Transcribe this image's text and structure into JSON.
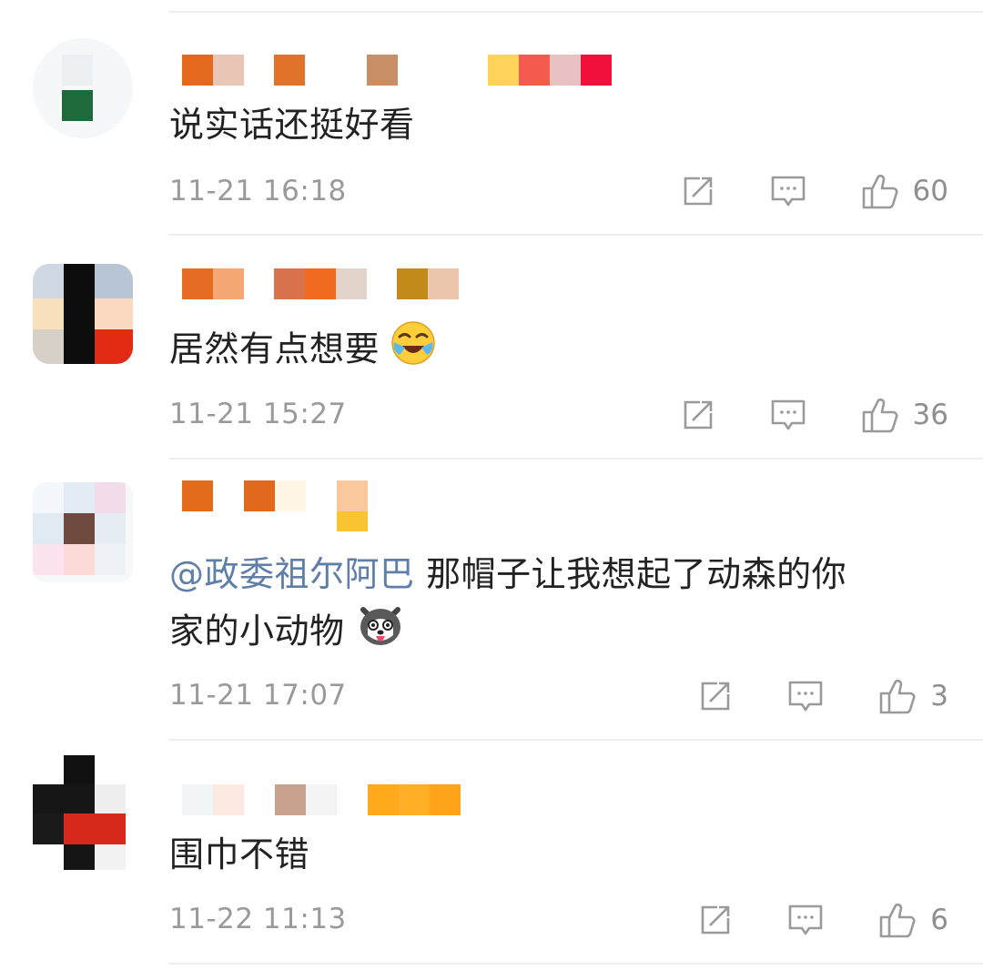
{
  "comments": [
    {
      "text": "说实话还挺好看",
      "time": "11-21 16:18",
      "likes": "60"
    },
    {
      "text": "居然有点想要",
      "emoji": "laugh-cry-emoji",
      "time": "11-21 15:27",
      "likes": "36"
    },
    {
      "mention": "@政委祖尔阿巴",
      "text_line1": " 那帽子让我想起了动森的你",
      "text_line2": "家的小动物",
      "emoji": "husky-emoji",
      "time": "11-21 17:07",
      "likes": "3"
    },
    {
      "text": "围巾不错",
      "time": "11-22 11:13",
      "likes": "6"
    }
  ],
  "icons": {
    "share": "share-icon",
    "reply": "comment-icon",
    "like": "thumbs-up-icon"
  },
  "colors": {
    "text": "#222222",
    "meta": "#9a9a9a",
    "mention": "#5f7fa9",
    "divider": "#efefef"
  }
}
